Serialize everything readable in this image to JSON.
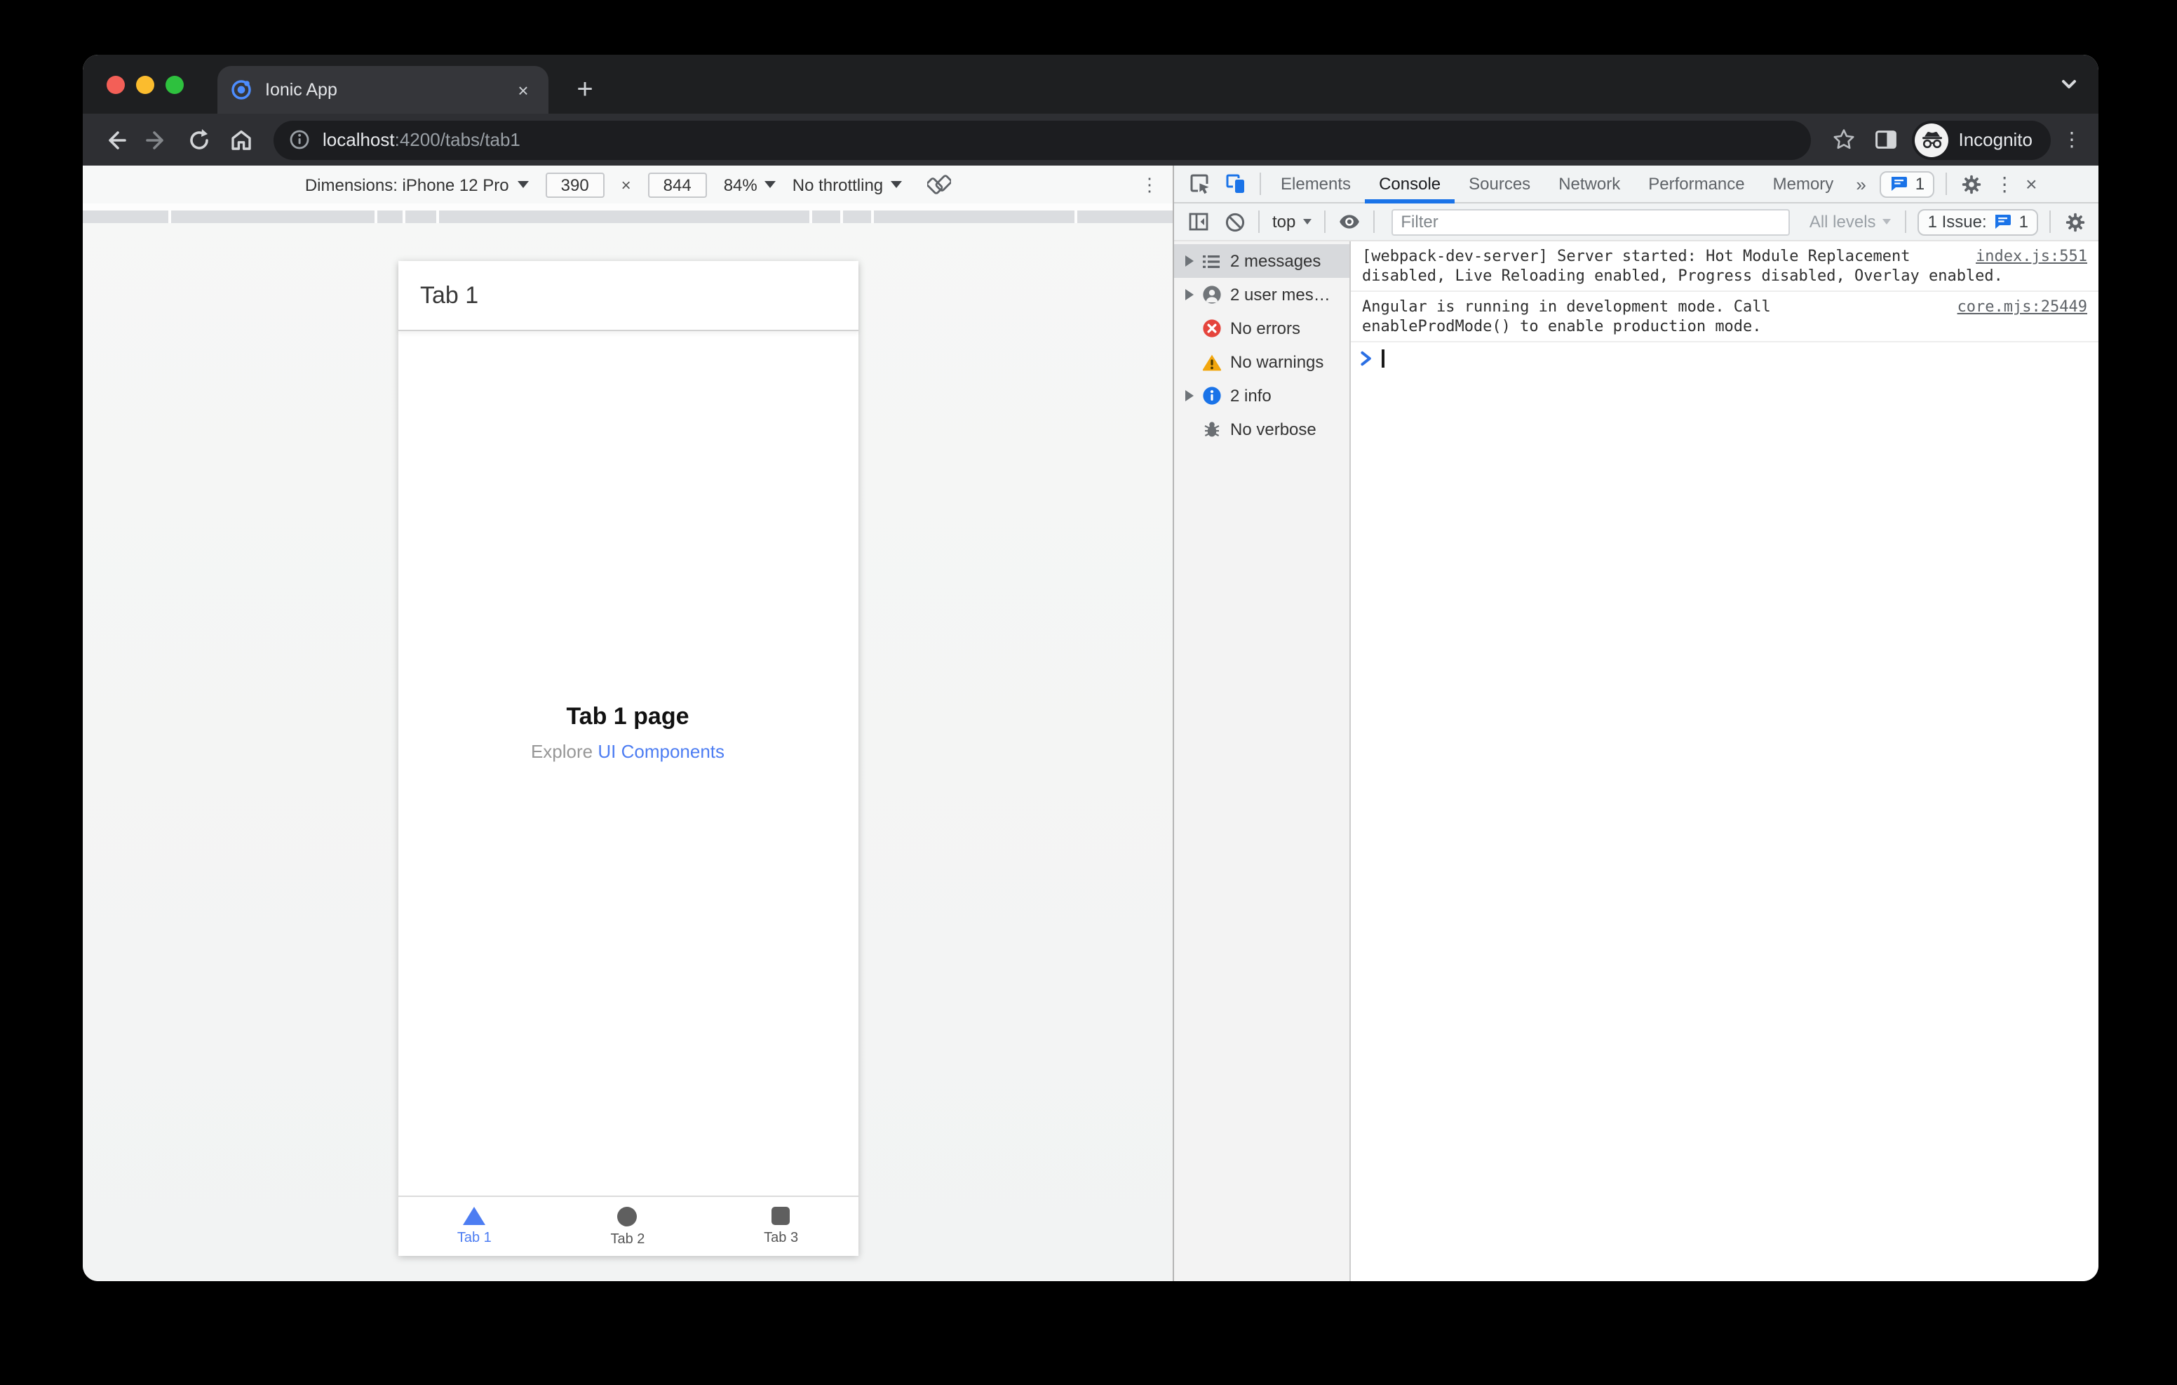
{
  "colors": {
    "devtools_accent": "#1a73e8",
    "ionic_blue": "#4d7df2",
    "error_red": "#e5443c",
    "warning_yellow": "#f2a60d",
    "info_blue": "#1a73e8",
    "incognito_dark": "#1c1d20"
  },
  "icons": {
    "close": "×",
    "new_tab": "+",
    "more_vertical": "⋮",
    "overflow_chevrons": "»"
  },
  "browser": {
    "tab_title": "Ionic App",
    "url": {
      "host": "localhost",
      "rest": ":4200/tabs/tab1"
    },
    "incognito_label": "Incognito"
  },
  "device_toolbar": {
    "dimensions_label": "Dimensions: iPhone 12 Pro",
    "width_value": "390",
    "separator": "×",
    "height_value": "844",
    "zoom_value": "84%",
    "throttling_label": "No throttling"
  },
  "devtools": {
    "tabs": [
      {
        "label": "Elements"
      },
      {
        "label": "Console"
      },
      {
        "label": "Sources"
      },
      {
        "label": "Network"
      },
      {
        "label": "Performance"
      },
      {
        "label": "Memory"
      }
    ],
    "issues_tab_count": "1",
    "toolbar": {
      "context": "top",
      "filter_placeholder": "Filter",
      "levels": "All levels",
      "issues_label": "1 Issue:",
      "issues_count": "1"
    },
    "sidebar": {
      "items": [
        {
          "label": "2 messages"
        },
        {
          "label": "2 user mes…"
        },
        {
          "label": "No errors"
        },
        {
          "label": "No warnings"
        },
        {
          "label": "2 info"
        },
        {
          "label": "No verbose"
        }
      ]
    },
    "console": {
      "messages": [
        {
          "text": "[webpack-dev-server] Server started: Hot Module Replacement disabled, Live Reloading enabled, Progress disabled, Overlay enabled.",
          "source": "index.js:551"
        },
        {
          "text": "Angular is running in development mode. Call enableProdMode() to enable production mode.",
          "source": "core.mjs:25449"
        }
      ]
    }
  },
  "app": {
    "header_title": "Tab 1",
    "page_title": "Tab 1 page",
    "explore_text": "Explore ",
    "explore_link": "UI Components",
    "tabs": [
      {
        "label": "Tab 1"
      },
      {
        "label": "Tab 2"
      },
      {
        "label": "Tab 3"
      }
    ]
  }
}
